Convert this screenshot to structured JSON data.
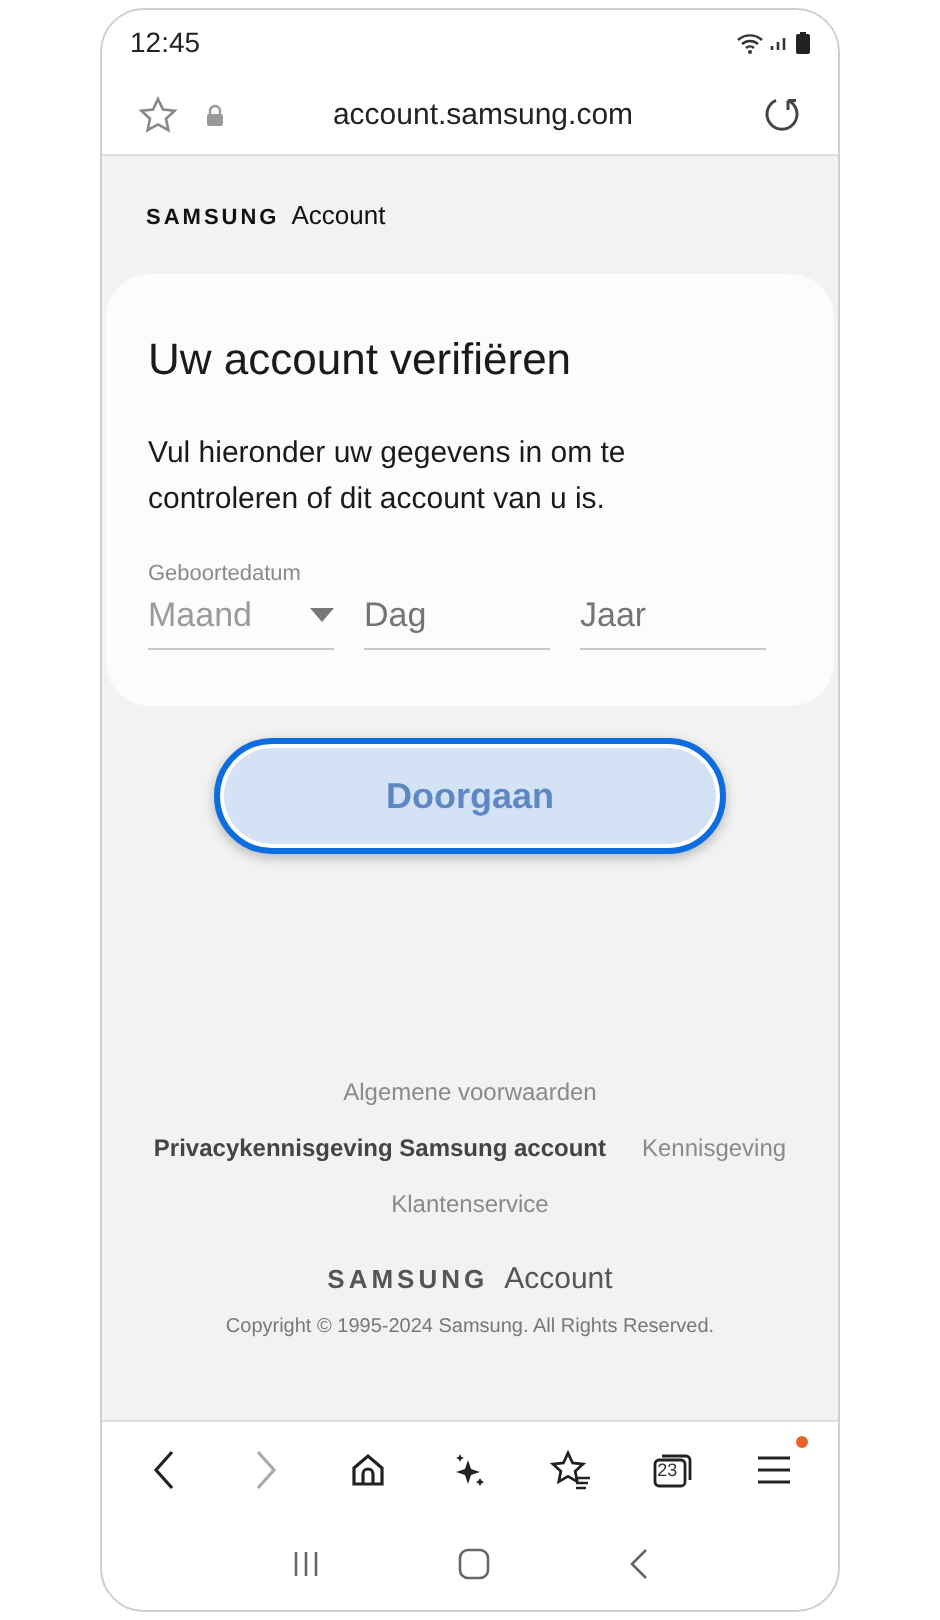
{
  "status_bar": {
    "time": "12:45"
  },
  "address_bar": {
    "url": "account.samsung.com"
  },
  "header": {
    "logo": "SAMSUNG",
    "product": "Account"
  },
  "card": {
    "title": "Uw account verifiëren",
    "description": "Vul hieronder uw gegevens in om te controleren of dit account van u is.",
    "birthdate_label": "Geboortedatum",
    "fields": [
      {
        "kind": "dropdown",
        "placeholder": "Maand"
      },
      {
        "kind": "text",
        "placeholder": "Dag"
      },
      {
        "kind": "text",
        "placeholder": "Jaar"
      }
    ]
  },
  "continue_button": {
    "label": "Doorgaan",
    "disabled": true,
    "focused": true
  },
  "footer": {
    "link_rows": [
      [
        {
          "label": "Algemene voorwaarden",
          "bold": false
        }
      ],
      [
        {
          "label": "Privacykennisgeving Samsung account",
          "bold": true
        },
        {
          "label": "Kennisgeving",
          "bold": false
        }
      ],
      [
        {
          "label": "Klantenservice",
          "bold": false
        }
      ]
    ],
    "logo": "SAMSUNG",
    "product": "Account",
    "copyright": "Copyright © 1995-2024 Samsung. All Rights Reserved."
  },
  "toolbar": [
    {
      "kind": "back",
      "disabled": false,
      "notification": false
    },
    {
      "kind": "forward",
      "disabled": true,
      "notification": false
    },
    {
      "kind": "home",
      "disabled": false,
      "notification": false
    },
    {
      "kind": "sparkle",
      "disabled": false,
      "notification": false
    },
    {
      "kind": "bookmarks",
      "disabled": false,
      "notification": false
    },
    {
      "kind": "tabs",
      "count": "23",
      "disabled": false,
      "notification": false
    },
    {
      "kind": "menu",
      "disabled": false,
      "notification": true
    }
  ]
}
